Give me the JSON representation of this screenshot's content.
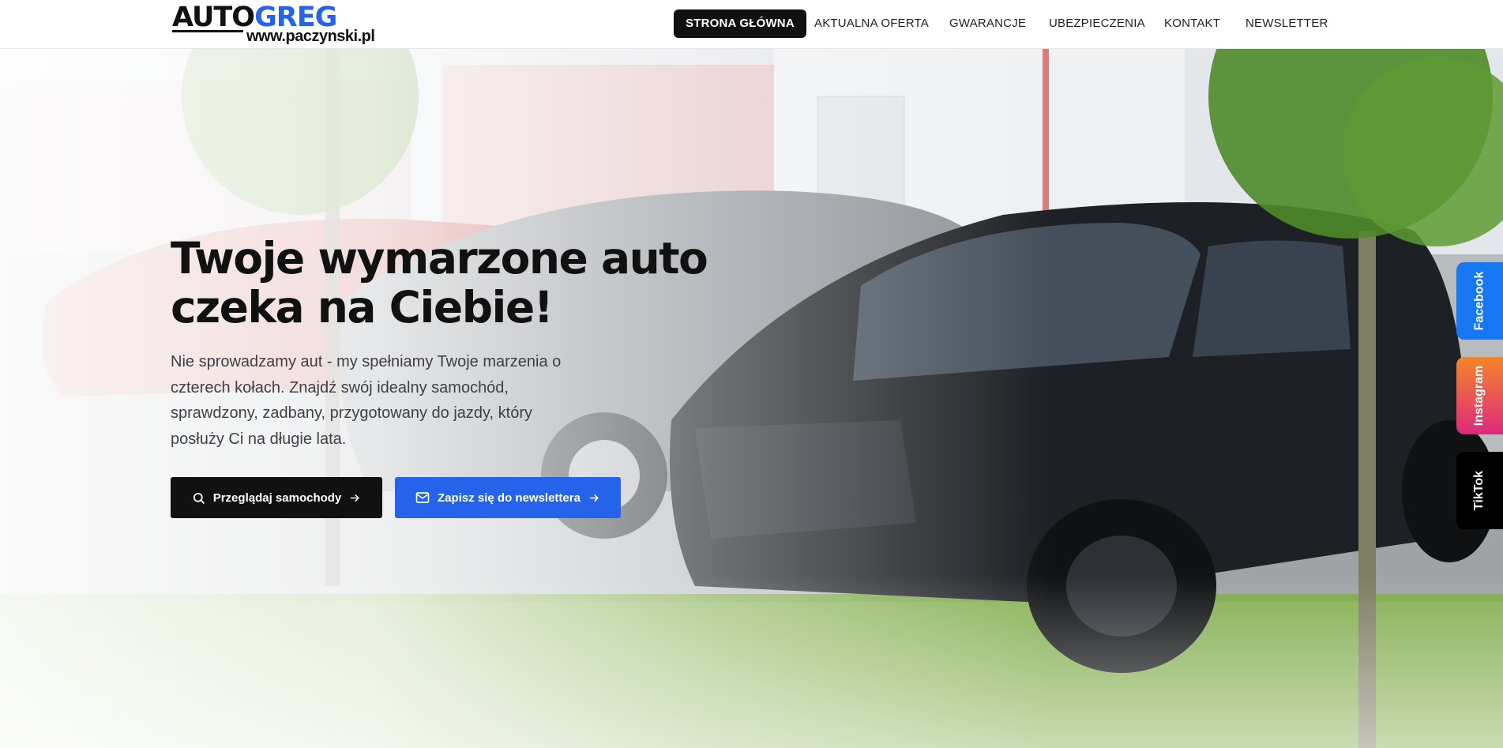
{
  "brand": {
    "logo_primary": "AUTO",
    "logo_accent": "GREG",
    "logo_url": "www.paczynski.pl"
  },
  "nav": {
    "items": [
      {
        "label": "STRONA GŁÓWNA",
        "active": true
      },
      {
        "label": "AKTUALNA OFERTA",
        "active": false
      },
      {
        "label": "GWARANCJE",
        "active": false
      },
      {
        "label": "UBEZPIECZENIA",
        "active": false
      },
      {
        "label": "KONTAKT",
        "active": false
      },
      {
        "label": "NEWSLETTER",
        "active": false
      }
    ]
  },
  "hero": {
    "title": "Twoje wymarzone auto czeka na Ciebie!",
    "text": "Nie sprowadzamy aut - my spełniamy Twoje marzenia o czterech kołach. Znajdź swój idealny samochód, sprawdzony, zadbany, przygotowany do jazdy, który posłuży Ci na długie lata.",
    "buttons": {
      "browse_label": "Przeglądaj samochody",
      "newsletter_label": "Zapisz się do newslettera"
    }
  },
  "social": {
    "facebook": "Facebook",
    "instagram": "Instagram",
    "tiktok": "TikTok"
  },
  "colors": {
    "accent_blue": "#2563eb",
    "dark": "#111111",
    "facebook": "#1877f2",
    "tiktok": "#000000"
  },
  "icons": [
    "search-icon",
    "arrow-right-icon",
    "mail-icon"
  ]
}
